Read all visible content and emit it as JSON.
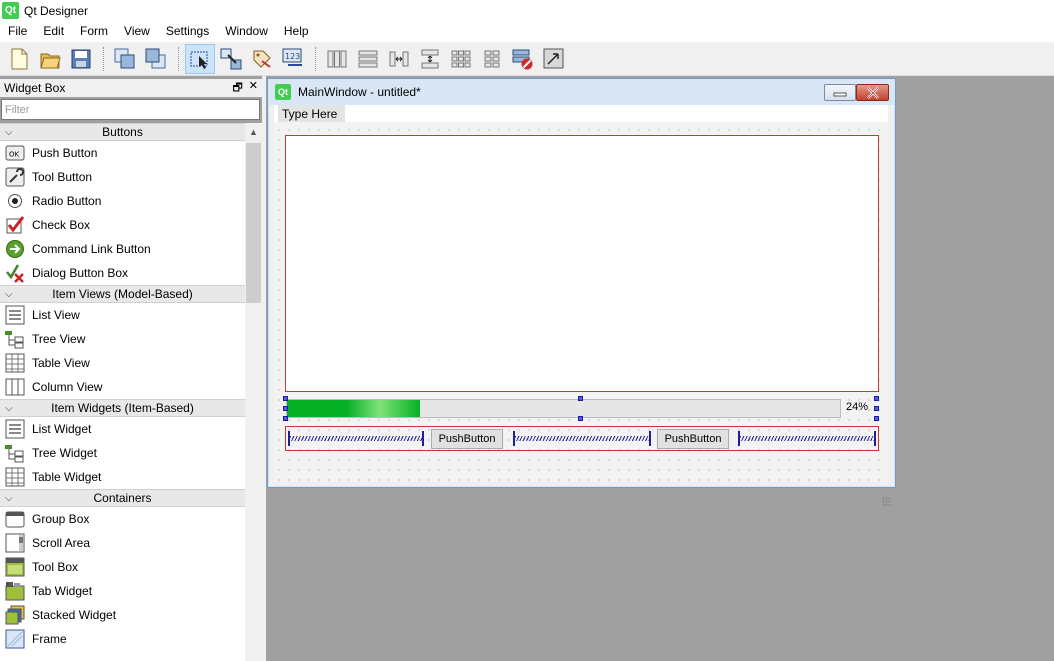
{
  "app": {
    "title": "Qt Designer",
    "logo": "Qt"
  },
  "menu": [
    "File",
    "Edit",
    "Form",
    "View",
    "Settings",
    "Window",
    "Help"
  ],
  "toolbar": {
    "icons": [
      "new-file-icon",
      "open-folder-icon",
      "save-icon",
      "send-to-back-icon",
      "bring-to-front-icon",
      "edit-widgets-icon",
      "edit-signals-slots-icon",
      "edit-buddies-icon",
      "edit-tab-order-icon",
      "layout-horizontal-icon",
      "layout-vertical-icon",
      "layout-horizontal-splitter-icon",
      "layout-vertical-splitter-icon",
      "layout-grid-icon",
      "layout-form-icon",
      "break-layout-icon",
      "adjust-size-icon"
    ]
  },
  "widget_box": {
    "title": "Widget Box",
    "filter_placeholder": "Filter",
    "categories": [
      {
        "label": "Buttons",
        "items": [
          "Push Button",
          "Tool Button",
          "Radio Button",
          "Check Box",
          "Command Link Button",
          "Dialog Button Box"
        ]
      },
      {
        "label": "Item Views (Model-Based)",
        "items": [
          "List View",
          "Tree View",
          "Table View",
          "Column View"
        ]
      },
      {
        "label": "Item Widgets (Item-Based)",
        "items": [
          "List Widget",
          "Tree Widget",
          "Table Widget"
        ]
      },
      {
        "label": "Containers",
        "items": [
          "Group Box",
          "Scroll Area",
          "Tool Box",
          "Tab Widget",
          "Stacked Widget",
          "Frame"
        ]
      }
    ]
  },
  "main_window": {
    "title": "MainWindow - untitled*",
    "logo": "Qt",
    "menu_placeholder": "Type Here",
    "progress_value": 24,
    "progress_text": "24%",
    "buttons": [
      "PushButton",
      "PushButton"
    ]
  },
  "colors": {
    "accent": "#06b025",
    "layout_border": "#cc3333",
    "handle": "#5858d8",
    "spacer": "#1f1f9a"
  }
}
